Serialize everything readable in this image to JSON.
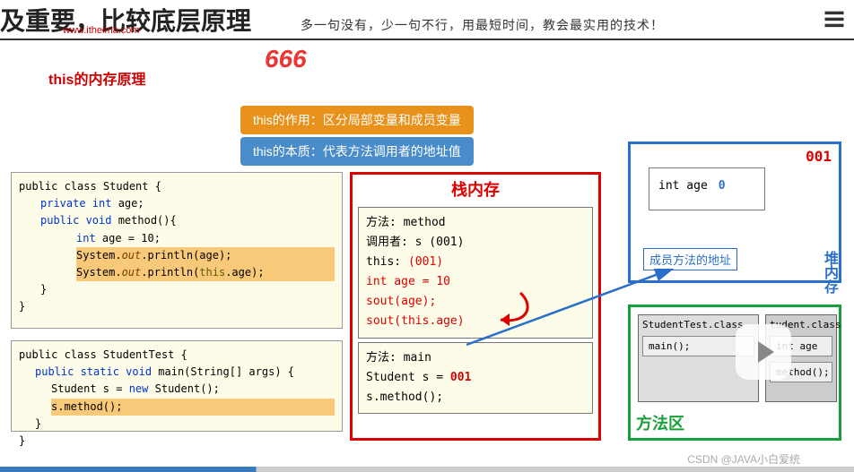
{
  "header": {
    "title": "及重要，比较底层原理",
    "url": "www.itheima.com",
    "slogan": "多一句没有，少一句不行，用最短时间，教会最实用的技术！"
  },
  "overlay_text": "666",
  "section_title": "this的内存原理",
  "tags": {
    "role": "this的作用：区分局部变量和成员变量",
    "essence": "this的本质：代表方法调用者的地址值"
  },
  "code_student": {
    "l1": "public class Student {",
    "l2": "private int age;",
    "l3": "public void method(){",
    "l4": "int age = 10;",
    "l5_a": "System.",
    "l5_b": "out",
    "l5_c": ".println(age);",
    "l6_a": "System.",
    "l6_b": "out",
    "l6_c": ".println(",
    "l6_d": "this",
    "l6_e": ".age);",
    "l7": "}",
    "l8": "}"
  },
  "code_test": {
    "l1": "public class StudentTest {",
    "l2": "public static void main(String[] args) {",
    "l3_a": "Student s = ",
    "l3_b": "new",
    "l3_c": " Student();",
    "l4": "s.method();",
    "l5": "}",
    "l6": "}"
  },
  "stack": {
    "title": "栈内存",
    "method_frame": {
      "l1": "方法: method",
      "l2": "调用者: s (001)",
      "l3_a": "this: ",
      "l3_b": "(001)",
      "l4": "int age = 10",
      "l5": "sout(age);",
      "l6": "sout(this.age)"
    },
    "main_frame": {
      "l1": "方法: main",
      "l2_a": "Student s = ",
      "l2_b": "001",
      "l3": "s.method();"
    }
  },
  "heap": {
    "address": "001",
    "field_name": "int age",
    "field_value": "0",
    "method_addr_label": "成员方法的地址",
    "label": "堆内存"
  },
  "method_area": {
    "class1": "StudentTest.class",
    "class2": "tudent.class",
    "main": "main();",
    "intage": "int age",
    "method": "method();",
    "label": "方法区"
  },
  "watermark": "CSDN @JAVA小白爱统"
}
